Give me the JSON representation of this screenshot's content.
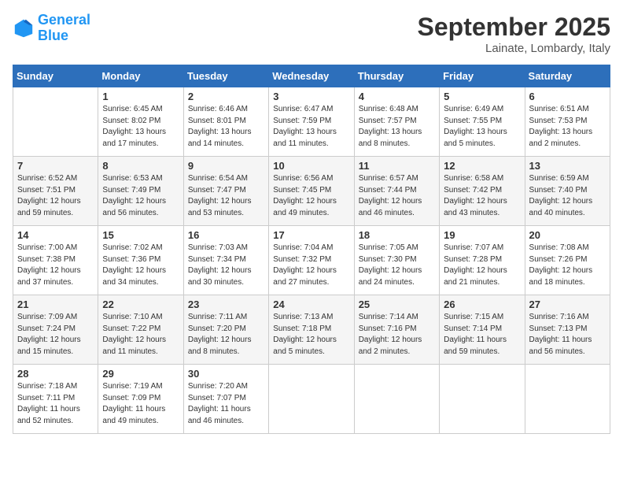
{
  "header": {
    "logo_line1": "General",
    "logo_line2": "Blue",
    "month_title": "September 2025",
    "location": "Lainate, Lombardy, Italy"
  },
  "days_of_week": [
    "Sunday",
    "Monday",
    "Tuesday",
    "Wednesday",
    "Thursday",
    "Friday",
    "Saturday"
  ],
  "weeks": [
    [
      {
        "day": "",
        "info": ""
      },
      {
        "day": "1",
        "info": "Sunrise: 6:45 AM\nSunset: 8:02 PM\nDaylight: 13 hours\nand 17 minutes."
      },
      {
        "day": "2",
        "info": "Sunrise: 6:46 AM\nSunset: 8:01 PM\nDaylight: 13 hours\nand 14 minutes."
      },
      {
        "day": "3",
        "info": "Sunrise: 6:47 AM\nSunset: 7:59 PM\nDaylight: 13 hours\nand 11 minutes."
      },
      {
        "day": "4",
        "info": "Sunrise: 6:48 AM\nSunset: 7:57 PM\nDaylight: 13 hours\nand 8 minutes."
      },
      {
        "day": "5",
        "info": "Sunrise: 6:49 AM\nSunset: 7:55 PM\nDaylight: 13 hours\nand 5 minutes."
      },
      {
        "day": "6",
        "info": "Sunrise: 6:51 AM\nSunset: 7:53 PM\nDaylight: 13 hours\nand 2 minutes."
      }
    ],
    [
      {
        "day": "7",
        "info": "Sunrise: 6:52 AM\nSunset: 7:51 PM\nDaylight: 12 hours\nand 59 minutes."
      },
      {
        "day": "8",
        "info": "Sunrise: 6:53 AM\nSunset: 7:49 PM\nDaylight: 12 hours\nand 56 minutes."
      },
      {
        "day": "9",
        "info": "Sunrise: 6:54 AM\nSunset: 7:47 PM\nDaylight: 12 hours\nand 53 minutes."
      },
      {
        "day": "10",
        "info": "Sunrise: 6:56 AM\nSunset: 7:45 PM\nDaylight: 12 hours\nand 49 minutes."
      },
      {
        "day": "11",
        "info": "Sunrise: 6:57 AM\nSunset: 7:44 PM\nDaylight: 12 hours\nand 46 minutes."
      },
      {
        "day": "12",
        "info": "Sunrise: 6:58 AM\nSunset: 7:42 PM\nDaylight: 12 hours\nand 43 minutes."
      },
      {
        "day": "13",
        "info": "Sunrise: 6:59 AM\nSunset: 7:40 PM\nDaylight: 12 hours\nand 40 minutes."
      }
    ],
    [
      {
        "day": "14",
        "info": "Sunrise: 7:00 AM\nSunset: 7:38 PM\nDaylight: 12 hours\nand 37 minutes."
      },
      {
        "day": "15",
        "info": "Sunrise: 7:02 AM\nSunset: 7:36 PM\nDaylight: 12 hours\nand 34 minutes."
      },
      {
        "day": "16",
        "info": "Sunrise: 7:03 AM\nSunset: 7:34 PM\nDaylight: 12 hours\nand 30 minutes."
      },
      {
        "day": "17",
        "info": "Sunrise: 7:04 AM\nSunset: 7:32 PM\nDaylight: 12 hours\nand 27 minutes."
      },
      {
        "day": "18",
        "info": "Sunrise: 7:05 AM\nSunset: 7:30 PM\nDaylight: 12 hours\nand 24 minutes."
      },
      {
        "day": "19",
        "info": "Sunrise: 7:07 AM\nSunset: 7:28 PM\nDaylight: 12 hours\nand 21 minutes."
      },
      {
        "day": "20",
        "info": "Sunrise: 7:08 AM\nSunset: 7:26 PM\nDaylight: 12 hours\nand 18 minutes."
      }
    ],
    [
      {
        "day": "21",
        "info": "Sunrise: 7:09 AM\nSunset: 7:24 PM\nDaylight: 12 hours\nand 15 minutes."
      },
      {
        "day": "22",
        "info": "Sunrise: 7:10 AM\nSunset: 7:22 PM\nDaylight: 12 hours\nand 11 minutes."
      },
      {
        "day": "23",
        "info": "Sunrise: 7:11 AM\nSunset: 7:20 PM\nDaylight: 12 hours\nand 8 minutes."
      },
      {
        "day": "24",
        "info": "Sunrise: 7:13 AM\nSunset: 7:18 PM\nDaylight: 12 hours\nand 5 minutes."
      },
      {
        "day": "25",
        "info": "Sunrise: 7:14 AM\nSunset: 7:16 PM\nDaylight: 12 hours\nand 2 minutes."
      },
      {
        "day": "26",
        "info": "Sunrise: 7:15 AM\nSunset: 7:14 PM\nDaylight: 11 hours\nand 59 minutes."
      },
      {
        "day": "27",
        "info": "Sunrise: 7:16 AM\nSunset: 7:13 PM\nDaylight: 11 hours\nand 56 minutes."
      }
    ],
    [
      {
        "day": "28",
        "info": "Sunrise: 7:18 AM\nSunset: 7:11 PM\nDaylight: 11 hours\nand 52 minutes."
      },
      {
        "day": "29",
        "info": "Sunrise: 7:19 AM\nSunset: 7:09 PM\nDaylight: 11 hours\nand 49 minutes."
      },
      {
        "day": "30",
        "info": "Sunrise: 7:20 AM\nSunset: 7:07 PM\nDaylight: 11 hours\nand 46 minutes."
      },
      {
        "day": "",
        "info": ""
      },
      {
        "day": "",
        "info": ""
      },
      {
        "day": "",
        "info": ""
      },
      {
        "day": "",
        "info": ""
      }
    ]
  ]
}
